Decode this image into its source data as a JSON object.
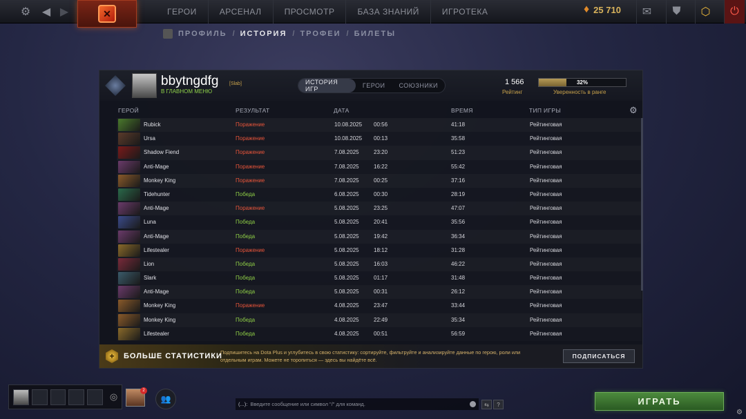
{
  "topbar": {
    "nav": [
      "ГЕРОИ",
      "АРСЕНАЛ",
      "ПРОСМОТР",
      "БАЗА ЗНАНИЙ",
      "ИГРОТЕКА"
    ],
    "currency": "25 710"
  },
  "subnav": {
    "items": [
      "ПРОФИЛЬ",
      "ИСТОРИЯ",
      "ТРОФЕИ",
      "БИЛЕТЫ"
    ],
    "separator": "/"
  },
  "profile": {
    "name": "bbytngdfg",
    "tag": "[Slab]",
    "status": "В ГЛАВНОМ МЕНЮ",
    "rating_value": "1 566",
    "rating_label": "Рейтинг",
    "confidence": "32%",
    "confidence_fraction": 0.32,
    "confidence_label": "Уверенность в ранге"
  },
  "tabs": [
    "ИСТОРИЯ ИГР",
    "ГЕРОИ",
    "СОЮЗНИКИ"
  ],
  "table": {
    "headers": [
      "ГЕРОЙ",
      "РЕЗУЛЬТАТ",
      "ДАТА",
      "ВРЕМЯ",
      "ТИП ИГРЫ"
    ],
    "rows": [
      {
        "hero": "Rubick",
        "result": "Поражение",
        "win": false,
        "date": "10.08.2025",
        "time": "00:56",
        "duration": "41:18",
        "type": "Рейтинговая",
        "color": "#4a7a2c"
      },
      {
        "hero": "Ursa",
        "result": "Поражение",
        "win": false,
        "date": "10.08.2025",
        "time": "00:13",
        "duration": "35:58",
        "type": "Рейтинговая",
        "color": "#5a3a2a"
      },
      {
        "hero": "Shadow Fiend",
        "result": "Поражение",
        "win": false,
        "date": "7.08.2025",
        "time": "23:20",
        "duration": "51:23",
        "type": "Рейтинговая",
        "color": "#7a1a1a"
      },
      {
        "hero": "Anti-Mage",
        "result": "Поражение",
        "win": false,
        "date": "7.08.2025",
        "time": "16:22",
        "duration": "55:42",
        "type": "Рейтинговая",
        "color": "#6a3a6a"
      },
      {
        "hero": "Monkey King",
        "result": "Поражение",
        "win": false,
        "date": "7.08.2025",
        "time": "00:25",
        "duration": "37:16",
        "type": "Рейтинговая",
        "color": "#8a5a2a"
      },
      {
        "hero": "Tidehunter",
        "result": "Победа",
        "win": true,
        "date": "6.08.2025",
        "time": "00:30",
        "duration": "28:19",
        "type": "Рейтинговая",
        "color": "#2a6a4a"
      },
      {
        "hero": "Anti-Mage",
        "result": "Поражение",
        "win": false,
        "date": "5.08.2025",
        "time": "23:25",
        "duration": "47:07",
        "type": "Рейтинговая",
        "color": "#6a3a6a"
      },
      {
        "hero": "Luna",
        "result": "Победа",
        "win": true,
        "date": "5.08.2025",
        "time": "20:41",
        "duration": "35:56",
        "type": "Рейтинговая",
        "color": "#3a4a8a"
      },
      {
        "hero": "Anti-Mage",
        "result": "Победа",
        "win": true,
        "date": "5.08.2025",
        "time": "19:42",
        "duration": "36:34",
        "type": "Рейтинговая",
        "color": "#6a3a6a"
      },
      {
        "hero": "Lifestealer",
        "result": "Поражение",
        "win": false,
        "date": "5.08.2025",
        "time": "18:12",
        "duration": "31:28",
        "type": "Рейтинговая",
        "color": "#8a6a2a"
      },
      {
        "hero": "Lion",
        "result": "Победа",
        "win": true,
        "date": "5.08.2025",
        "time": "16:03",
        "duration": "46:22",
        "type": "Рейтинговая",
        "color": "#7a2a3a"
      },
      {
        "hero": "Slark",
        "result": "Победа",
        "win": true,
        "date": "5.08.2025",
        "time": "01:17",
        "duration": "31:48",
        "type": "Рейтинговая",
        "color": "#3a5a6a"
      },
      {
        "hero": "Anti-Mage",
        "result": "Победа",
        "win": true,
        "date": "5.08.2025",
        "time": "00:31",
        "duration": "26:12",
        "type": "Рейтинговая",
        "color": "#6a3a6a"
      },
      {
        "hero": "Monkey King",
        "result": "Поражение",
        "win": false,
        "date": "4.08.2025",
        "time": "23:47",
        "duration": "33:44",
        "type": "Рейтинговая",
        "color": "#8a5a2a"
      },
      {
        "hero": "Monkey King",
        "result": "Победа",
        "win": true,
        "date": "4.08.2025",
        "time": "22:49",
        "duration": "35:34",
        "type": "Рейтинговая",
        "color": "#8a5a2a"
      },
      {
        "hero": "Lifestealer",
        "result": "Победа",
        "win": true,
        "date": "4.08.2025",
        "time": "00:51",
        "duration": "56:59",
        "type": "Рейтинговая",
        "color": "#8a6a2a"
      }
    ]
  },
  "plus": {
    "title": "БОЛЬШЕ СТАТИСТИКИ",
    "description": "Подпишитесь на Dota Plus и углубитесь в свою статистику: сортируйте, фильтруйте и анализируйте данные по герою, роли или отдельным играм. Можете не торопиться — здесь вы найдёте всё.",
    "button": "ПОДПИСАТЬСЯ"
  },
  "bottom": {
    "notification_count": "2",
    "chat_prefix": "(...):",
    "chat_placeholder": "Введите сообщение или символ \"/\" для команд.",
    "help": "?",
    "play": "ИГРАТЬ"
  }
}
